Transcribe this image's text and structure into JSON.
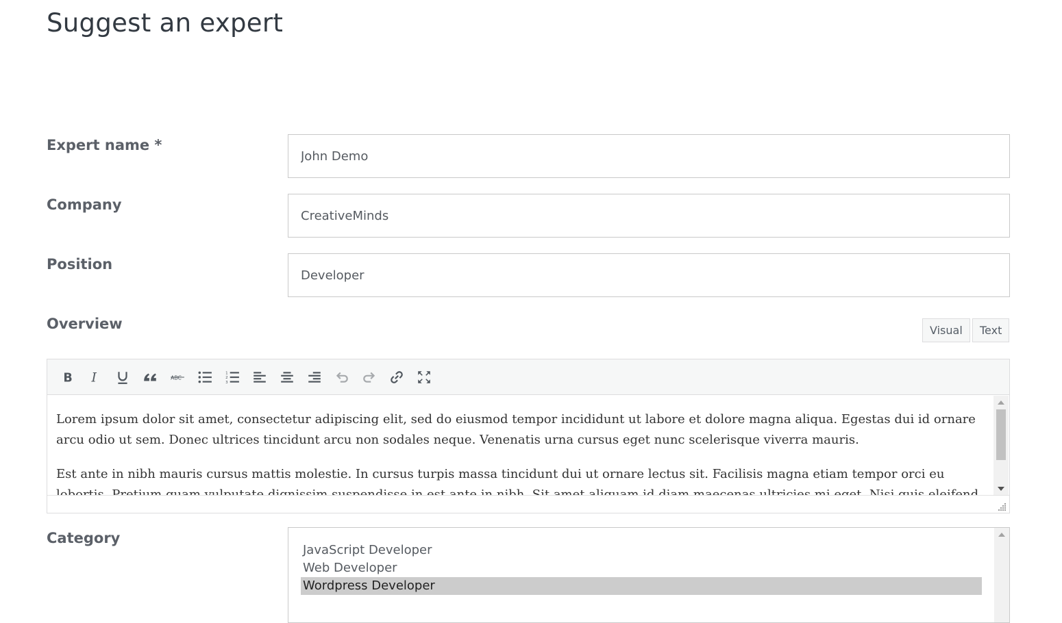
{
  "page": {
    "title": "Suggest an expert"
  },
  "fields": {
    "expert_name": {
      "label": "Expert name *",
      "value": "John Demo"
    },
    "company": {
      "label": "Company",
      "value": "CreativeMinds"
    },
    "position": {
      "label": "Position",
      "value": "Developer"
    },
    "overview": {
      "label": "Overview",
      "tabs": {
        "visual": "Visual",
        "text": "Text"
      },
      "toolbar": [
        "bold-icon",
        "italic-icon",
        "underline-icon",
        "blockquote-icon",
        "strikethrough-icon",
        "bullet-list-icon",
        "numbered-list-icon",
        "align-left-icon",
        "align-center-icon",
        "align-right-icon",
        "undo-icon",
        "redo-icon",
        "link-icon",
        "fullscreen-icon"
      ],
      "paragraphs": [
        "Lorem ipsum dolor sit amet, consectetur adipiscing elit, sed do eiusmod tempor incididunt ut labore et dolore magna aliqua. Egestas dui id ornare arcu odio ut sem. Donec ultrices tincidunt arcu non sodales neque. Venenatis urna cursus eget nunc scelerisque viverra mauris.",
        "Est ante in nibh mauris cursus mattis molestie. In cursus turpis massa tincidunt dui ut ornare lectus sit. Facilisis magna etiam tempor orci eu lobortis. Pretium quam vulputate dignissim suspendisse in est ante in nibh. Sit amet aliquam id diam maecenas ultricies mi eget. Nisi quis eleifend quam"
      ]
    },
    "category": {
      "label": "Category",
      "options": [
        "JavaScript Developer",
        "Web Developer",
        "Wordpress Developer"
      ],
      "selected": "Wordpress Developer"
    }
  },
  "colors": {
    "selected_option_bg": "#cccccc",
    "label": "#5b6068",
    "border": "#c9c9c9"
  }
}
